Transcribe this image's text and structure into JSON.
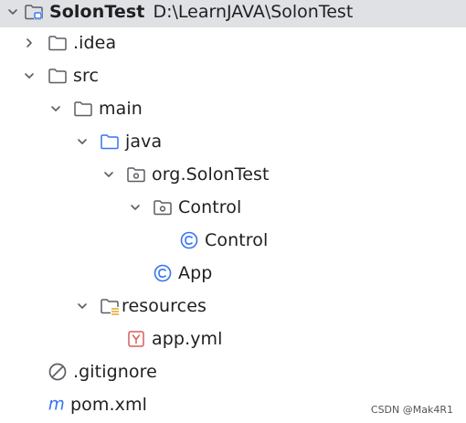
{
  "project": {
    "name": "SolonTest",
    "path": "D:\\LearnJAVA\\SolonTest"
  },
  "tree": {
    "idea": ".idea",
    "src": "src",
    "main": "main",
    "java": "java",
    "package": "org.SolonTest",
    "control_folder": "Control",
    "control_class": "Control",
    "app_class": "App",
    "resources": "resources",
    "app_yml": "app.yml",
    "gitignore": ".gitignore",
    "pom": "pom.xml"
  },
  "icons": {
    "module_folder": "module-folder-icon",
    "folder": "folder-icon",
    "source_folder": "source-root-folder-icon",
    "package": "package-icon",
    "class": "java-class-icon",
    "resources_folder": "resources-root-folder-icon",
    "yaml": "yaml-file-icon",
    "gitignore": "ignore-file-icon",
    "maven": "maven-pom-icon"
  },
  "colors": {
    "selection": "#dfe1e5",
    "accent_blue": "#3574f0",
    "yaml_red": "#db5c5c",
    "resources_yellow": "#e0a52c",
    "icon_gray": "#5a5d63",
    "text": "#1f1f1f"
  },
  "watermark": "CSDN @Mak4R1"
}
